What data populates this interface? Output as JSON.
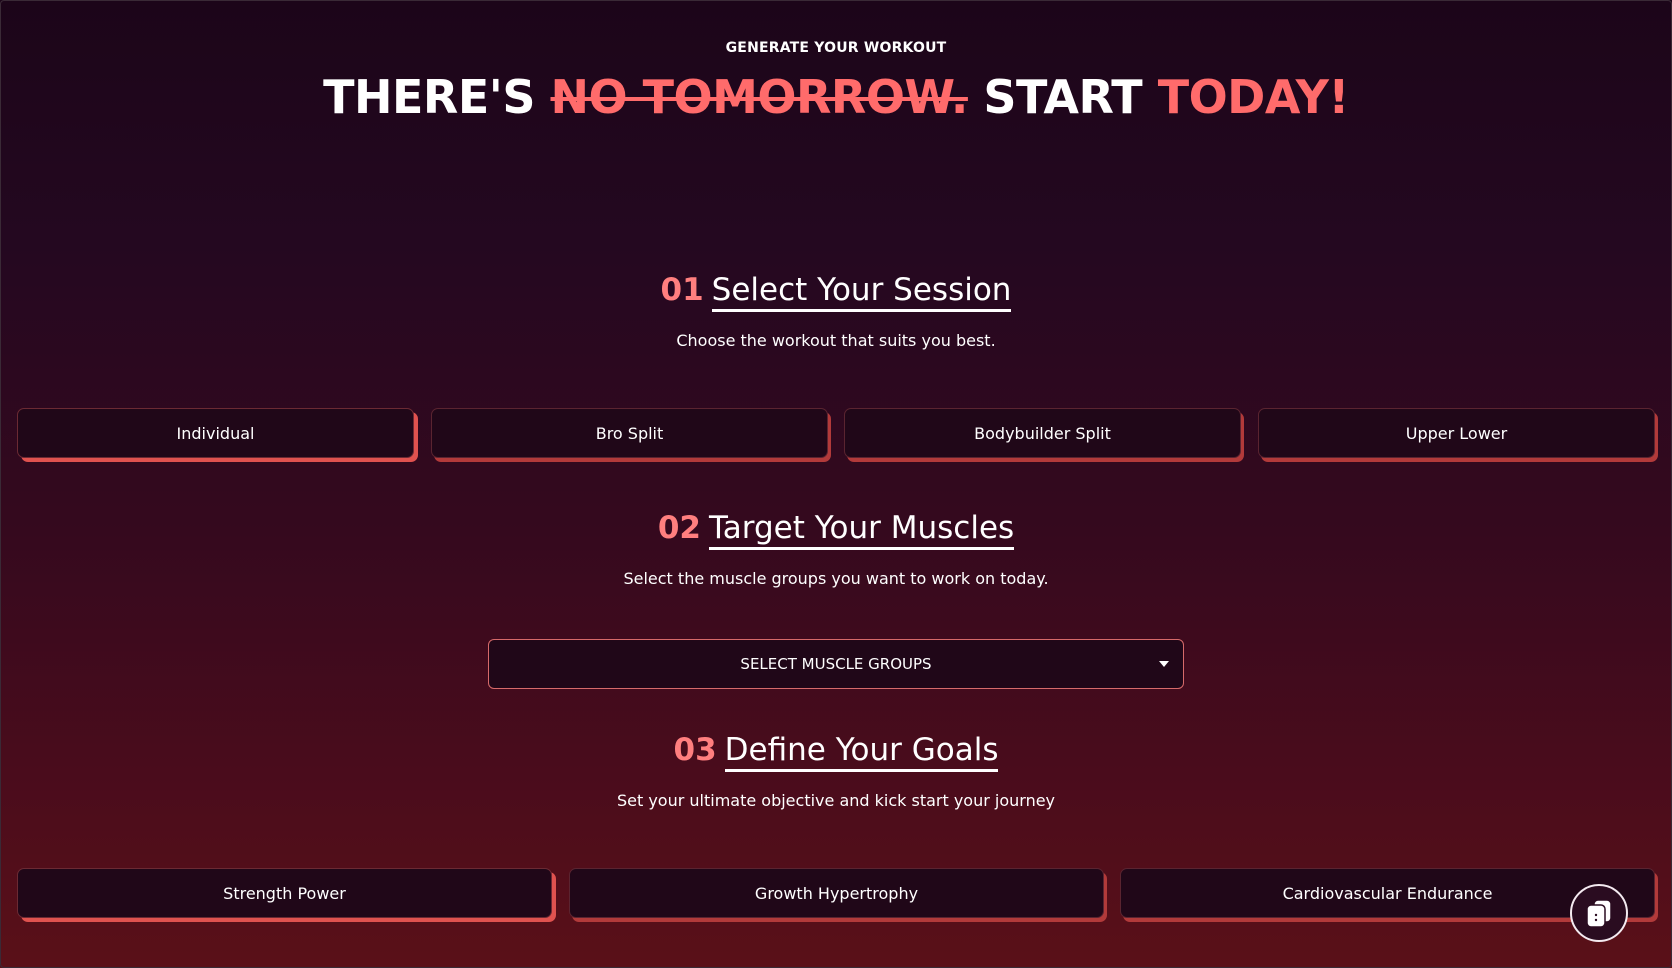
{
  "header": {
    "eyebrow": "GENERATE YOUR WORKOUT",
    "headline_part1": "THERE'S ",
    "headline_strike": "NO TOMORROW.",
    "headline_part2": " START ",
    "headline_accent": "TODAY!"
  },
  "sections": [
    {
      "number": "01",
      "title": "Select Your Session",
      "subtitle": "Choose the workout that suits you best.",
      "options": [
        "Individual",
        "Bro Split",
        "Bodybuilder Split",
        "Upper Lower"
      ],
      "selected": "Individual"
    },
    {
      "number": "02",
      "title": "Target Your Muscles",
      "subtitle": "Select the muscle groups you want to work on today.",
      "dropdown_label": "SELECT MUSCLE GROUPS"
    },
    {
      "number": "03",
      "title": "Define Your Goals",
      "subtitle": "Set your ultimate objective and kick start your journey",
      "options": [
        "Strength Power",
        "Growth Hypertrophy",
        "Cardiovascular Endurance"
      ],
      "selected": "Strength Power"
    }
  ],
  "fab": {
    "icon": "chat-cards-icon"
  },
  "colors": {
    "accent": "#ff6b6b",
    "button_bg": "#200718",
    "button_shadow": "#b23a3a"
  }
}
